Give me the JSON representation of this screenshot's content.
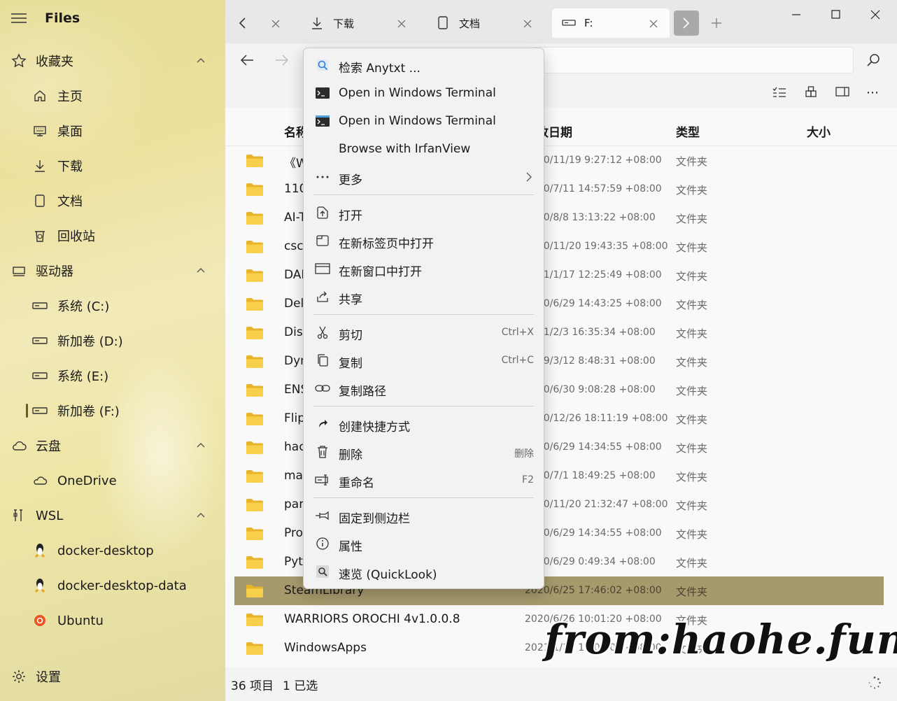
{
  "app": {
    "title": "Files"
  },
  "sidebar": {
    "favorites": {
      "label": "收藏夹",
      "items": [
        "主页",
        "桌面",
        "下载",
        "文档",
        "回收站"
      ]
    },
    "drives": {
      "label": "驱动器",
      "items": [
        "系统 (C:)",
        "新加卷 (D:)",
        "系统 (E:)",
        "新加卷 (F:)"
      ]
    },
    "cloud": {
      "label": "云盘",
      "items": [
        "OneDrive"
      ]
    },
    "wsl": {
      "label": "WSL",
      "items": [
        "docker-desktop",
        "docker-desktop-data",
        "Ubuntu"
      ]
    },
    "settings": "设置"
  },
  "tabs": [
    {
      "label": "下载",
      "icon": "download-icon"
    },
    {
      "label": "文档",
      "icon": "document-icon"
    },
    {
      "label": "F:",
      "icon": "drive-icon",
      "active": true
    }
  ],
  "columns": {
    "name": "名称",
    "date": "修改日期",
    "type": "类型",
    "size": "大小"
  },
  "files": [
    {
      "name": "《W",
      "date": "2020/11/19 9:27:12 +08:00",
      "type": "文件夹"
    },
    {
      "name": "110",
      "date": "2020/7/11 14:57:59 +08:00",
      "type": "文件夹"
    },
    {
      "name": "AI-T",
      "date": "2020/8/8 13:13:22 +08:00",
      "type": "文件夹"
    },
    {
      "name": "csca",
      "date": "2020/11/20 19:43:35 +08:00",
      "type": "文件夹"
    },
    {
      "name": "DAI",
      "date": "2021/1/17 12:25:49 +08:00",
      "type": "文件夹"
    },
    {
      "name": "Del",
      "date": "2020/6/29 14:43:25 +08:00",
      "type": "文件夹"
    },
    {
      "name": "Dish",
      "date": "2021/2/3 16:35:34 +08:00",
      "type": "文件夹"
    },
    {
      "name": "Dyn",
      "date": "2019/3/12 8:48:31 +08:00",
      "type": "文件夹"
    },
    {
      "name": "ENS",
      "date": "2020/6/30 9:08:28 +08:00",
      "type": "文件夹"
    },
    {
      "name": "Flip",
      "date": "2020/12/26 18:11:19 +08:00",
      "type": "文件夹"
    },
    {
      "name": "hac",
      "date": "2020/6/29 14:34:55 +08:00",
      "type": "文件夹"
    },
    {
      "name": "mal",
      "date": "2020/7/1 18:49:25 +08:00",
      "type": "文件夹"
    },
    {
      "name": "pan",
      "date": "2020/11/20 21:32:47 +08:00",
      "type": "文件夹"
    },
    {
      "name": "Pro",
      "date": "2020/6/29 14:34:55 +08:00",
      "type": "文件夹"
    },
    {
      "name": "Pytl",
      "date": "2020/6/29 0:49:34 +08:00",
      "type": "文件夹"
    },
    {
      "name": "SteamLibrary",
      "date": "2020/6/25 17:46:02 +08:00",
      "type": "文件夹",
      "selected": true
    },
    {
      "name": "WARRIORS OROCHI 4v1.0.0.8",
      "date": "2020/6/26 10:01:20 +08:00",
      "type": "文件夹"
    },
    {
      "name": "WindowsApps",
      "date": "2021/1/13 13:06:09 +08:00",
      "type": "文件夹"
    }
  ],
  "status": {
    "count": "36 项目",
    "selected": "1 已选"
  },
  "context_menu": {
    "items": [
      {
        "label": "检索 Anytxt ...",
        "icon": "anytxt-search-icon"
      },
      {
        "label": "Open in Windows Terminal",
        "icon": "terminal-icon"
      },
      {
        "label": "Open in Windows Terminal",
        "icon": "terminal-preview-icon"
      },
      {
        "label": "Browse with IrfanView",
        "icon": ""
      },
      {
        "label": "更多",
        "icon": "more-icon"
      },
      {
        "label": "打开",
        "icon": "open-icon"
      },
      {
        "label": "在新标签页中打开",
        "icon": "new-tab-icon"
      },
      {
        "label": "在新窗口中打开",
        "icon": "new-window-icon"
      },
      {
        "label": "共享",
        "icon": "share-icon"
      },
      {
        "label": "剪切",
        "icon": "cut-icon",
        "shortcut": "Ctrl+X"
      },
      {
        "label": "复制",
        "icon": "copy-icon",
        "shortcut": "Ctrl+C"
      },
      {
        "label": "复制路径",
        "icon": "copy-path-icon"
      },
      {
        "label": "创建快捷方式",
        "icon": "shortcut-icon"
      },
      {
        "label": "删除",
        "icon": "delete-icon",
        "shortcut": "删除"
      },
      {
        "label": "重命名",
        "icon": "rename-icon",
        "shortcut": "F2"
      },
      {
        "label": "固定到侧边栏",
        "icon": "pin-icon"
      },
      {
        "label": "属性",
        "icon": "info-icon"
      },
      {
        "label": "速览 (QuickLook)",
        "icon": "quicklook-icon"
      }
    ]
  },
  "watermark": "from:haohe.fun",
  "colors": {
    "accent": "#6b5a22",
    "selection": "#a69a6d",
    "folder": "#f2c037"
  }
}
